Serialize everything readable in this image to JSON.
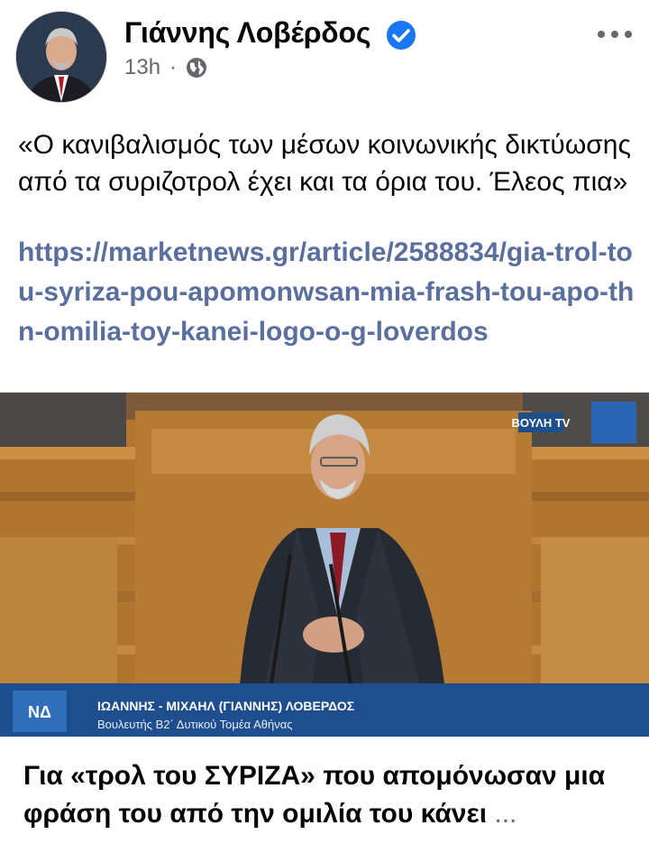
{
  "post": {
    "author": "Γιάννης Λοβέρδος",
    "time": "13h",
    "separator": "·",
    "audience_icon": "globe-icon",
    "more_icon": "more-dots-icon",
    "text": "«Ο κανιβαλισμός των μέσων κοινωνικής δικτύωσης από τα συριζοτρολ έχει και τα όρια του. Έλεος πια»",
    "link": "https://marketnews.gr/article/2588834/gia-trol-tou-syriza-pou-apomonwsan-mia-frash-tou-apo-thn-omilia-toy-kanei-logo-o-g-loverdos"
  },
  "video": {
    "channel_logo": "ΒΟΥΛΗ TV",
    "party_logo": "ΝΔ",
    "lower_third_name": "ΙΩΑΝΝΗΣ - ΜΙΧΑΗΛ (ΓΙΑΝΝΗΣ) ΛΟΒΕΡΔΟΣ",
    "lower_third_role": "Βουλευτής Β2΄ Δυτικού Τομέα Αθήνας"
  },
  "link_preview": {
    "title": "Για «τρολ του ΣΥΡΙΖΑ» που απομόνωσαν μια φράση του από την ομιλία του κάνει",
    "ellipsis": "..."
  },
  "colors": {
    "link": "#5b6f9e",
    "verified": "#1877f2",
    "meta": "#65676b"
  }
}
